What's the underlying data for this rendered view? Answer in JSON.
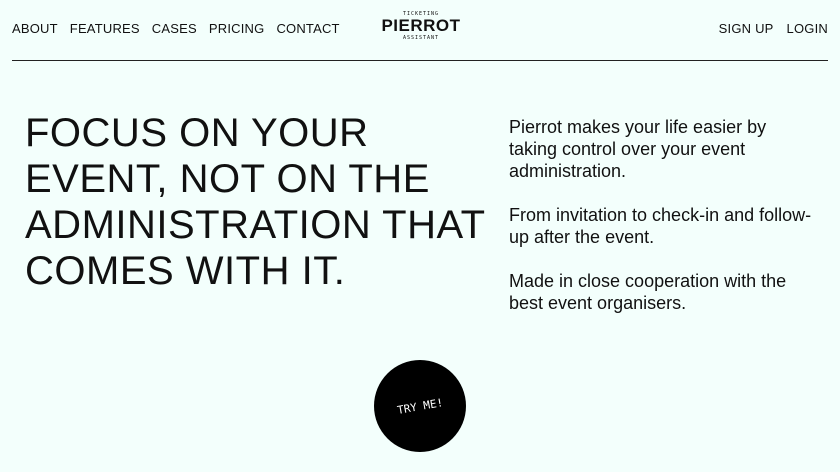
{
  "nav_left": [
    {
      "label": "ABOUT"
    },
    {
      "label": "FEATURES"
    },
    {
      "label": "CASES"
    },
    {
      "label": "PRICING"
    },
    {
      "label": "CONTACT"
    }
  ],
  "logo": {
    "top": "TICKETING",
    "name": "PIERROT",
    "bottom": "ASSISTANT"
  },
  "nav_right": {
    "signup": "SIGN UP",
    "login": "LOGIN"
  },
  "hero": {
    "headline": "FOCUS ON YOUR EVENT, NOT ON THE ADMINISTRATION THAT COMES WITH IT.",
    "paragraphs": [
      "Pierrot makes your life easier by taking control over your event administration.",
      "From invitation to check-in and follow-up after the event.",
      "Made in close cooperation with the best event organisers."
    ],
    "cta": "TRY ME!"
  }
}
